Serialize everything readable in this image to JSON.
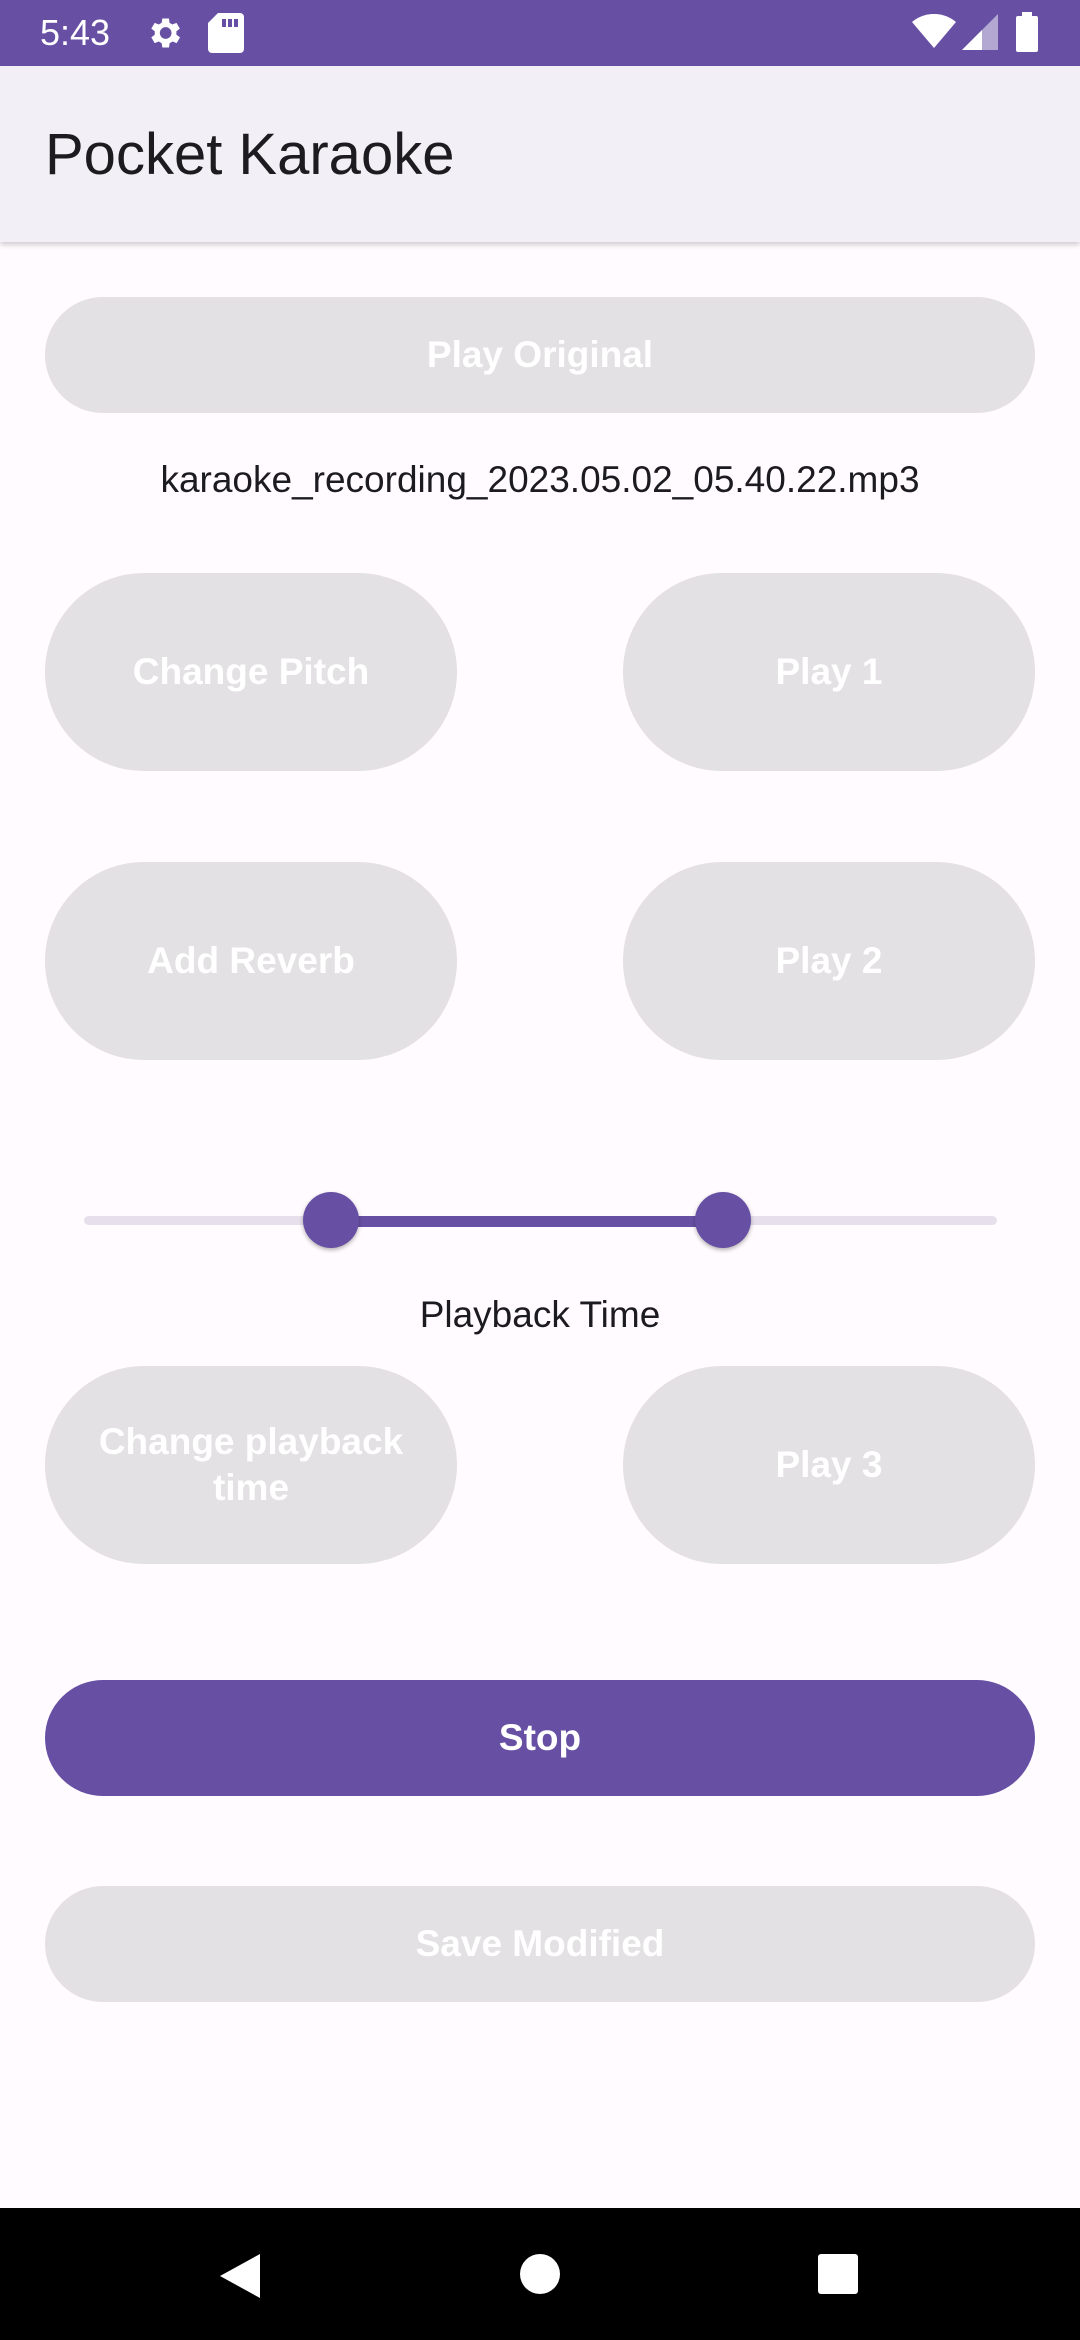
{
  "status_bar": {
    "time": "5:43",
    "left_icons": [
      "gear-icon",
      "sd-card-icon"
    ],
    "right_icons": [
      "wifi-icon",
      "cell-signal-icon",
      "battery-icon"
    ]
  },
  "app_bar": {
    "title": "Pocket Karaoke"
  },
  "buttons": {
    "play_original": "Play Original",
    "change_pitch": "Change Pitch",
    "play_1": "Play 1",
    "add_reverb": "Add Reverb",
    "play_2": "Play 2",
    "change_playback_time": "Change playback time",
    "play_3": "Play 3",
    "stop": "Stop",
    "save_modified": "Save Modified"
  },
  "file": {
    "name": "karaoke_recording_2023.05.02_05.40.22.mp3"
  },
  "playback_slider": {
    "label": "Playback Time",
    "range_start_fraction": 0.27,
    "range_end_fraction": 0.7
  },
  "colors": {
    "primary": "#6750A4",
    "disabled_button": "#E3E1E3",
    "background": "#FFFBFE",
    "app_bar": "#F3EFF6"
  },
  "nav_bar": {
    "icons": [
      "back-icon",
      "home-icon",
      "recents-icon"
    ]
  }
}
